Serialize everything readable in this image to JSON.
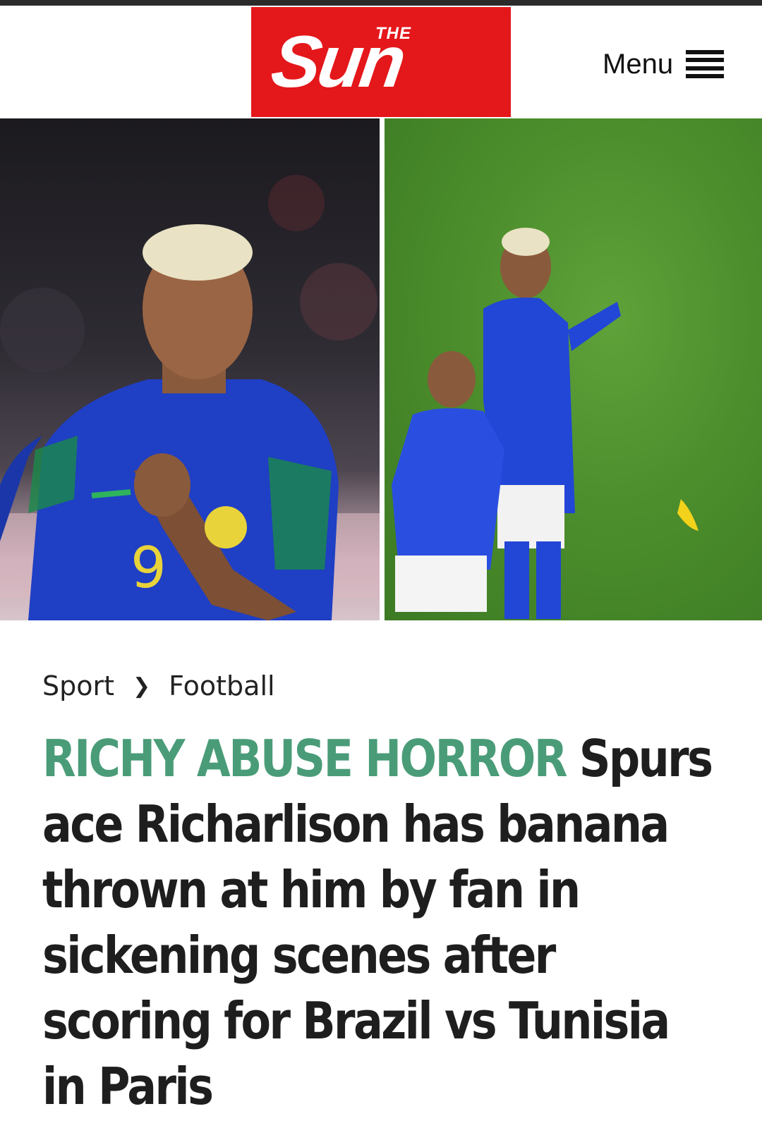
{
  "header": {
    "logo_the": "THE",
    "logo_sun": "Sun",
    "brand_color": "#e4171b",
    "menu_label": "Menu",
    "menu_icon": "hamburger-icon"
  },
  "hero": {
    "left_photo": "Richarlison celebrating in Brazil shirt number 9",
    "right_photo": "Richarlison on pitch with banana thrown nearby"
  },
  "breadcrumb": {
    "items": [
      "Sport",
      "Football"
    ],
    "separator_icon": "chevron-right-icon"
  },
  "article": {
    "kicker": "RICHY ABUSE HORROR",
    "kicker_color": "#4a9c78",
    "headline": "Spurs ace Richarlison has banana thrown at him by fan in sickening scenes after scoring for Brazil vs Tunisia in Paris"
  }
}
